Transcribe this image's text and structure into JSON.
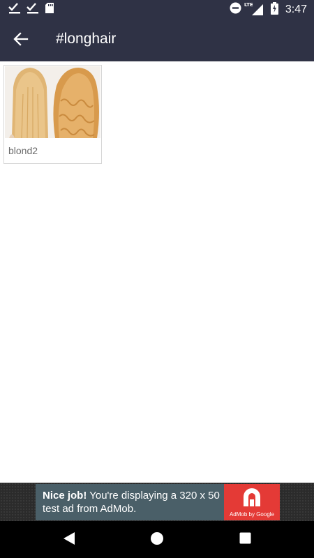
{
  "status_bar": {
    "time": "3:47",
    "network": "LTE",
    "icons": [
      "check-icon",
      "check-icon",
      "sd-card-icon",
      "do-not-disturb-icon",
      "signal-icon",
      "battery-charging-icon"
    ]
  },
  "app_bar": {
    "title": "#longhair",
    "back_icon": "arrow-left-icon"
  },
  "grid": {
    "items": [
      {
        "caption": "blond2",
        "image": "blonde-hair-photo"
      }
    ]
  },
  "ad": {
    "bold": "Nice job!",
    "text": " You're displaying a 320 x 50 test ad from AdMob.",
    "brand": "AdMob by Google",
    "colors": {
      "banner": "#4a5f68",
      "logo": "#e43a36"
    }
  },
  "nav_bar": {
    "buttons": [
      "back-triangle-icon",
      "home-circle-icon",
      "recents-square-icon"
    ]
  },
  "colors": {
    "toolbar": "#2f3245",
    "background": "#ffffff"
  }
}
